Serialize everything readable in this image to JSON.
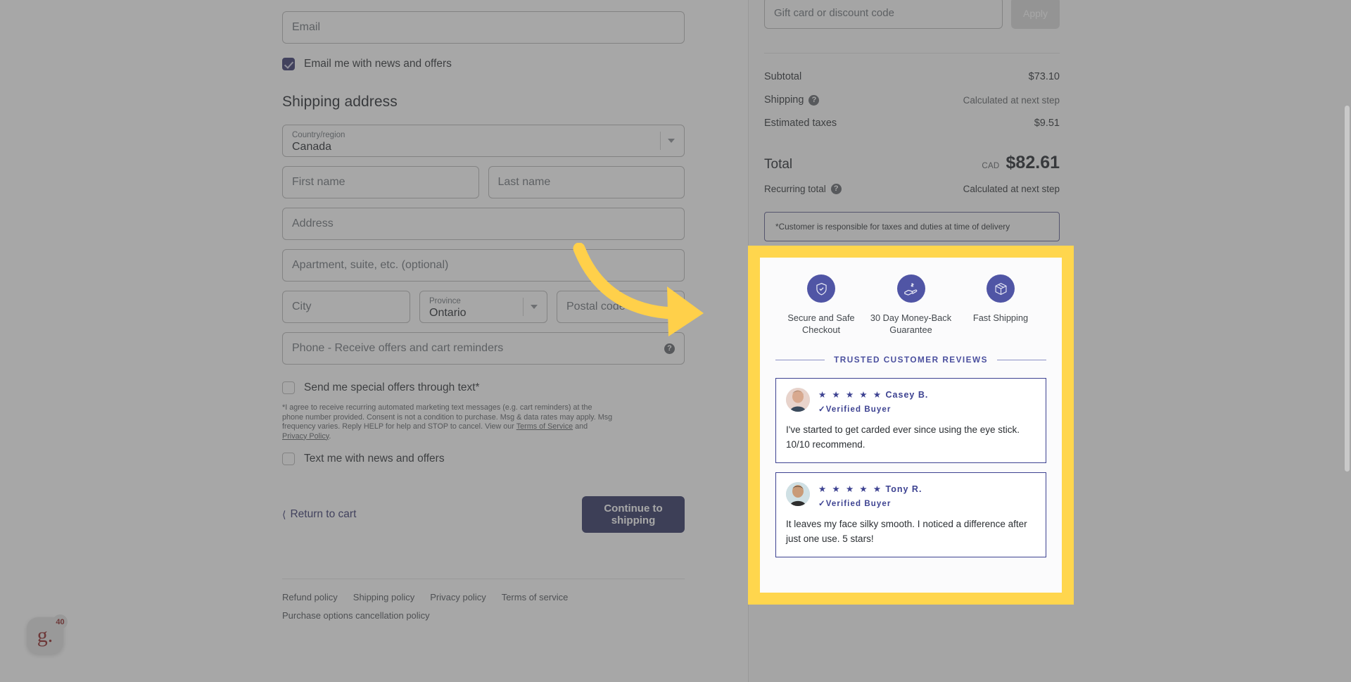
{
  "form": {
    "email_placeholder": "Email",
    "email_optin_label": "Email me with news and offers",
    "shipping_title": "Shipping address",
    "country_label": "Country/region",
    "country_value": "Canada",
    "first_name_placeholder": "First name",
    "last_name_placeholder": "Last name",
    "address_placeholder": "Address",
    "apartment_placeholder": "Apartment, suite, etc. (optional)",
    "city_placeholder": "City",
    "province_label": "Province",
    "province_value": "Ontario",
    "postal_placeholder": "Postal code",
    "phone_placeholder": "Phone - Receive offers and cart reminders",
    "sms_optin_label": "Send me special offers through text*",
    "legal_text_1": "*I agree to receive recurring automated marketing text messages (e.g. cart reminders) at the phone number provided. Consent is not a condition to purchase. Msg & data rates may apply. Msg frequency varies. Reply HELP for help and STOP to cancel. View our ",
    "legal_link_tos": "Terms of Service",
    "legal_and": " and ",
    "legal_link_privacy": "Privacy Policy",
    "legal_period": ".",
    "text_optin_label": "Text me with news and offers",
    "return_to_cart": "Return to cart",
    "continue_button": "Continue to shipping"
  },
  "footer": {
    "links": [
      "Refund policy",
      "Shipping policy",
      "Privacy policy",
      "Terms of service"
    ],
    "second_row_link": "Purchase options cancellation policy"
  },
  "summary": {
    "discount_placeholder": "Gift card or discount code",
    "apply_label": "Apply",
    "lines": [
      {
        "label": "Subtotal",
        "value": "$73.10",
        "muted": false,
        "help": false
      },
      {
        "label": "Shipping",
        "value": "Calculated at next step",
        "muted": true,
        "help": true
      },
      {
        "label": "Estimated taxes",
        "value": "$9.51",
        "muted": false,
        "help": false
      }
    ],
    "total_label": "Total",
    "total_currency": "CAD",
    "total_amount": "$82.61",
    "recurring_label": "Recurring total",
    "recurring_value": "Calculated at next step",
    "notice": "*Customer is responsible for taxes and duties at time of delivery"
  },
  "trust": {
    "badges": [
      {
        "icon": "shield-check-icon",
        "label": "Secure and Safe Checkout"
      },
      {
        "icon": "money-back-hand-icon",
        "label": "30 Day Money-Back Guarantee"
      },
      {
        "icon": "package-box-icon",
        "label": "Fast Shipping"
      }
    ],
    "reviews_heading": "TRUSTED CUSTOMER REVIEWS",
    "reviews": [
      {
        "stars": "★ ★ ★ ★ ★",
        "name": "Casey B.",
        "verified": "✓Verified Buyer",
        "body": "I've started to get carded ever since using the eye stick. 10/10 recommend."
      },
      {
        "stars": "★ ★ ★ ★ ★",
        "name": "Tony R.",
        "verified": "✓Verified Buyer",
        "body": "It leaves my face silky smooth. I noticed a difference after just one use. 5 stars!"
      }
    ]
  },
  "chat": {
    "logo_text": "g.",
    "badge_count": "40"
  },
  "colors": {
    "brand_navy": "#2b2e5e",
    "accent_purple": "#5055a5",
    "highlight_yellow": "#ffd64d",
    "arrow_yellow": "#ffd04a"
  }
}
